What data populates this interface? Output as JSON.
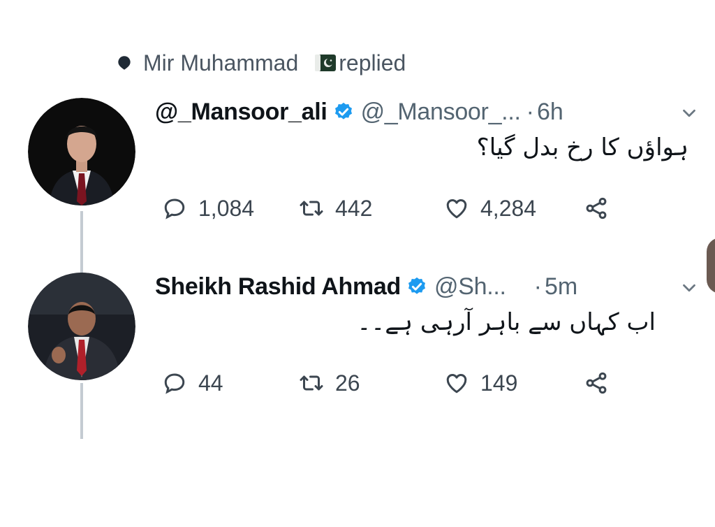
{
  "context": {
    "name": "Mir Muhammad",
    "action": "replied",
    "icon": "reply-dot-icon",
    "flag_icon": "pakistan-flag-icon"
  },
  "tweets": [
    {
      "display_name": "@_Mansoor_ali",
      "handle": "@_Mansoor_...",
      "separator": "·",
      "time": "6h",
      "text": "ہواؤں کا رخ بدل گیا؟",
      "verified": true,
      "counts": {
        "replies": "1,084",
        "retweets": "442",
        "likes": "4,284"
      }
    },
    {
      "display_name": "Sheikh Rashid Ahmad",
      "handle": "@Sh...",
      "separator": "·",
      "time": "5m",
      "text": "اب کہاں سے باہر آرہی ہے۔۔",
      "verified": true,
      "counts": {
        "replies": "44",
        "retweets": "26",
        "likes": "149"
      }
    }
  ],
  "colors": {
    "verified": "#1d9bf0",
    "text": "#0f1419",
    "secondary": "#536471",
    "thread_line": "#c4cbd2"
  }
}
